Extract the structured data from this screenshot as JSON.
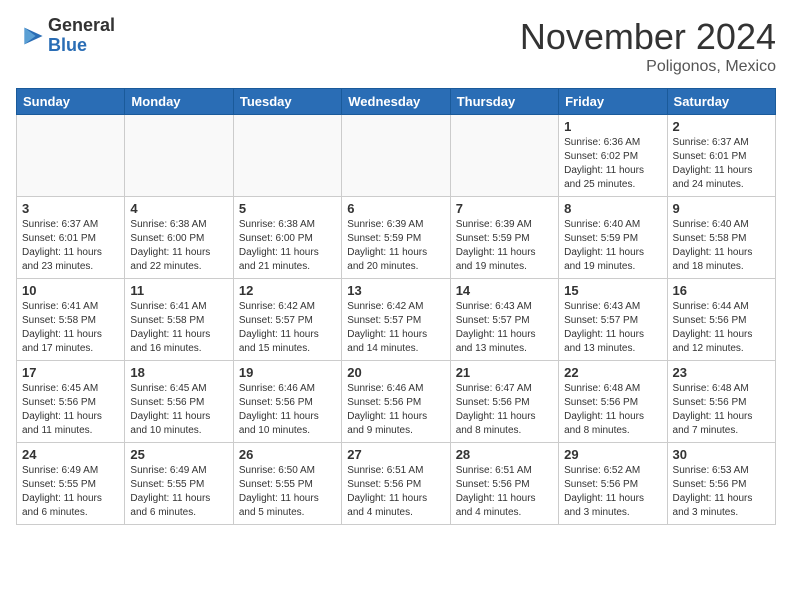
{
  "header": {
    "logo_general": "General",
    "logo_blue": "Blue",
    "month_title": "November 2024",
    "location": "Poligonos, Mexico"
  },
  "weekdays": [
    "Sunday",
    "Monday",
    "Tuesday",
    "Wednesday",
    "Thursday",
    "Friday",
    "Saturday"
  ],
  "weeks": [
    [
      {
        "day": "",
        "info": ""
      },
      {
        "day": "",
        "info": ""
      },
      {
        "day": "",
        "info": ""
      },
      {
        "day": "",
        "info": ""
      },
      {
        "day": "",
        "info": ""
      },
      {
        "day": "1",
        "info": "Sunrise: 6:36 AM\nSunset: 6:02 PM\nDaylight: 11 hours\nand 25 minutes."
      },
      {
        "day": "2",
        "info": "Sunrise: 6:37 AM\nSunset: 6:01 PM\nDaylight: 11 hours\nand 24 minutes."
      }
    ],
    [
      {
        "day": "3",
        "info": "Sunrise: 6:37 AM\nSunset: 6:01 PM\nDaylight: 11 hours\nand 23 minutes."
      },
      {
        "day": "4",
        "info": "Sunrise: 6:38 AM\nSunset: 6:00 PM\nDaylight: 11 hours\nand 22 minutes."
      },
      {
        "day": "5",
        "info": "Sunrise: 6:38 AM\nSunset: 6:00 PM\nDaylight: 11 hours\nand 21 minutes."
      },
      {
        "day": "6",
        "info": "Sunrise: 6:39 AM\nSunset: 5:59 PM\nDaylight: 11 hours\nand 20 minutes."
      },
      {
        "day": "7",
        "info": "Sunrise: 6:39 AM\nSunset: 5:59 PM\nDaylight: 11 hours\nand 19 minutes."
      },
      {
        "day": "8",
        "info": "Sunrise: 6:40 AM\nSunset: 5:59 PM\nDaylight: 11 hours\nand 19 minutes."
      },
      {
        "day": "9",
        "info": "Sunrise: 6:40 AM\nSunset: 5:58 PM\nDaylight: 11 hours\nand 18 minutes."
      }
    ],
    [
      {
        "day": "10",
        "info": "Sunrise: 6:41 AM\nSunset: 5:58 PM\nDaylight: 11 hours\nand 17 minutes."
      },
      {
        "day": "11",
        "info": "Sunrise: 6:41 AM\nSunset: 5:58 PM\nDaylight: 11 hours\nand 16 minutes."
      },
      {
        "day": "12",
        "info": "Sunrise: 6:42 AM\nSunset: 5:57 PM\nDaylight: 11 hours\nand 15 minutes."
      },
      {
        "day": "13",
        "info": "Sunrise: 6:42 AM\nSunset: 5:57 PM\nDaylight: 11 hours\nand 14 minutes."
      },
      {
        "day": "14",
        "info": "Sunrise: 6:43 AM\nSunset: 5:57 PM\nDaylight: 11 hours\nand 13 minutes."
      },
      {
        "day": "15",
        "info": "Sunrise: 6:43 AM\nSunset: 5:57 PM\nDaylight: 11 hours\nand 13 minutes."
      },
      {
        "day": "16",
        "info": "Sunrise: 6:44 AM\nSunset: 5:56 PM\nDaylight: 11 hours\nand 12 minutes."
      }
    ],
    [
      {
        "day": "17",
        "info": "Sunrise: 6:45 AM\nSunset: 5:56 PM\nDaylight: 11 hours\nand 11 minutes."
      },
      {
        "day": "18",
        "info": "Sunrise: 6:45 AM\nSunset: 5:56 PM\nDaylight: 11 hours\nand 10 minutes."
      },
      {
        "day": "19",
        "info": "Sunrise: 6:46 AM\nSunset: 5:56 PM\nDaylight: 11 hours\nand 10 minutes."
      },
      {
        "day": "20",
        "info": "Sunrise: 6:46 AM\nSunset: 5:56 PM\nDaylight: 11 hours\nand 9 minutes."
      },
      {
        "day": "21",
        "info": "Sunrise: 6:47 AM\nSunset: 5:56 PM\nDaylight: 11 hours\nand 8 minutes."
      },
      {
        "day": "22",
        "info": "Sunrise: 6:48 AM\nSunset: 5:56 PM\nDaylight: 11 hours\nand 8 minutes."
      },
      {
        "day": "23",
        "info": "Sunrise: 6:48 AM\nSunset: 5:56 PM\nDaylight: 11 hours\nand 7 minutes."
      }
    ],
    [
      {
        "day": "24",
        "info": "Sunrise: 6:49 AM\nSunset: 5:55 PM\nDaylight: 11 hours\nand 6 minutes."
      },
      {
        "day": "25",
        "info": "Sunrise: 6:49 AM\nSunset: 5:55 PM\nDaylight: 11 hours\nand 6 minutes."
      },
      {
        "day": "26",
        "info": "Sunrise: 6:50 AM\nSunset: 5:55 PM\nDaylight: 11 hours\nand 5 minutes."
      },
      {
        "day": "27",
        "info": "Sunrise: 6:51 AM\nSunset: 5:56 PM\nDaylight: 11 hours\nand 4 minutes."
      },
      {
        "day": "28",
        "info": "Sunrise: 6:51 AM\nSunset: 5:56 PM\nDaylight: 11 hours\nand 4 minutes."
      },
      {
        "day": "29",
        "info": "Sunrise: 6:52 AM\nSunset: 5:56 PM\nDaylight: 11 hours\nand 3 minutes."
      },
      {
        "day": "30",
        "info": "Sunrise: 6:53 AM\nSunset: 5:56 PM\nDaylight: 11 hours\nand 3 minutes."
      }
    ]
  ]
}
